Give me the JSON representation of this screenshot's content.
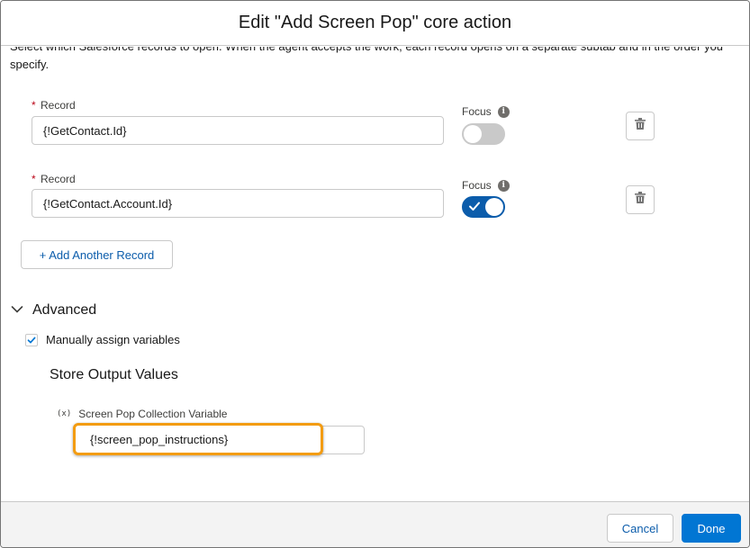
{
  "modal": {
    "title": "Edit \"Add Screen Pop\" core action"
  },
  "intro_text": "Select which Salesforce records to open. When the agent accepts the work, each record opens on a separate subtab and in the order you specify.",
  "records": [
    {
      "label": "Record",
      "required_marker": "*",
      "value": "{!GetContact.Id}",
      "focus_label": "Focus",
      "focus_enabled": false
    },
    {
      "label": "Record",
      "required_marker": "*",
      "value": "{!GetContact.Account.Id}",
      "focus_label": "Focus",
      "focus_enabled": true
    }
  ],
  "add_record_label": "+ Add Another Record",
  "advanced": {
    "title": "Advanced",
    "expanded": true,
    "manual_assign_label": "Manually assign variables",
    "manual_assign_checked": true,
    "store_output_title": "Store Output Values",
    "collection_variable_label": "Screen Pop Collection Variable",
    "collection_variable_icon": "(x)",
    "collection_variable_value": "{!screen_pop_instructions}"
  },
  "footer": {
    "cancel_label": "Cancel",
    "done_label": "Done"
  },
  "colors": {
    "brand": "#0176d3",
    "toggle_on": "#0b5cab",
    "highlight": "#f39c12"
  }
}
